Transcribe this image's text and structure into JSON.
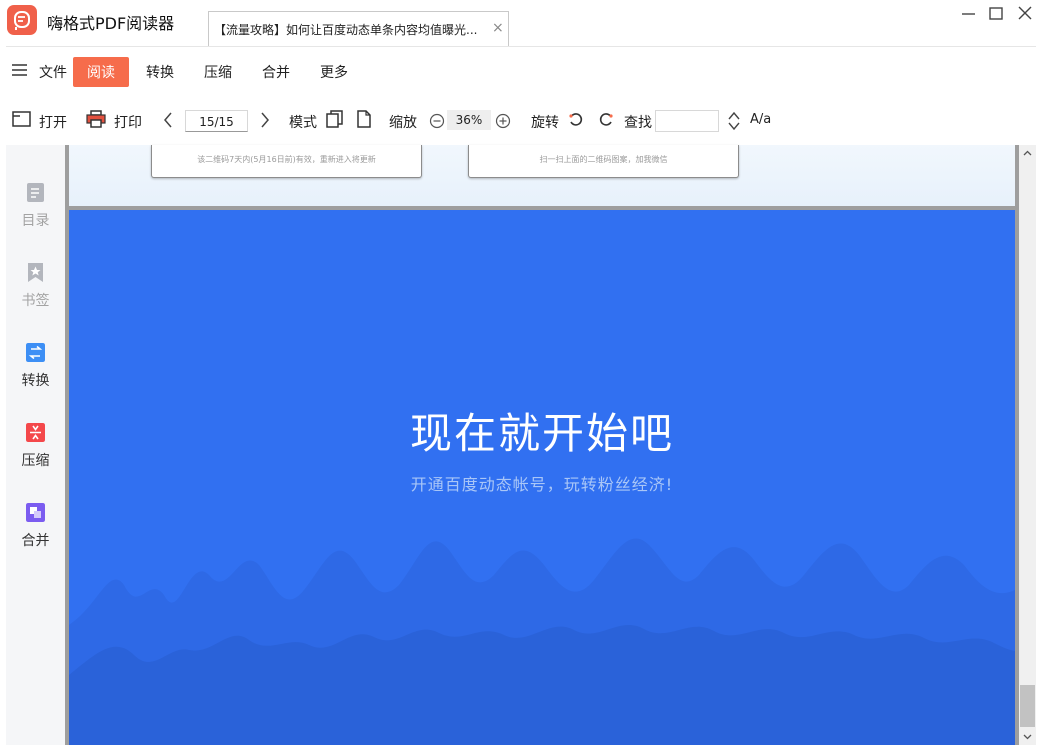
{
  "app": {
    "title": "嗨格式PDF阅读器",
    "tab_label": "【流量攻略】如何让百度动态单条内容均值曝光...",
    "tab_close": "×"
  },
  "menu": {
    "items": [
      {
        "label": "文件"
      },
      {
        "label": "阅读",
        "active": true
      },
      {
        "label": "转换"
      },
      {
        "label": "压缩"
      },
      {
        "label": "合并"
      },
      {
        "label": "更多"
      }
    ]
  },
  "toolbar": {
    "open_label": "打开",
    "print_label": "打印",
    "page_value": "15/15",
    "mode_label": "模式",
    "zoom_label": "缩放",
    "zoom_value": "36%",
    "rotate_label": "旋转",
    "search_label": "查找",
    "case_label": "A/a"
  },
  "sidebar": {
    "items": [
      {
        "label": "目录",
        "icon": "toc-icon"
      },
      {
        "label": "书签",
        "icon": "bookmark-icon"
      },
      {
        "label": "转换",
        "icon": "convert-icon",
        "color": "#3d8ff5"
      },
      {
        "label": "压缩",
        "icon": "compress-icon",
        "color": "#f4484b"
      },
      {
        "label": "合并",
        "icon": "merge-icon",
        "color": "#7b5cf0"
      }
    ]
  },
  "document": {
    "qr_left_text": "该二维码7天内(5月16日前)有效，重新进入将更新",
    "qr_right_text": "扫一扫上面的二维码图案，加我微信",
    "hero_title": "现在就开始吧",
    "hero_subtitle": "开通百度动态帐号，玩转粉丝经济!",
    "hero_color": "#3170f1"
  },
  "colors": {
    "accent": "#f66c4b",
    "logo": "#f0604a"
  }
}
